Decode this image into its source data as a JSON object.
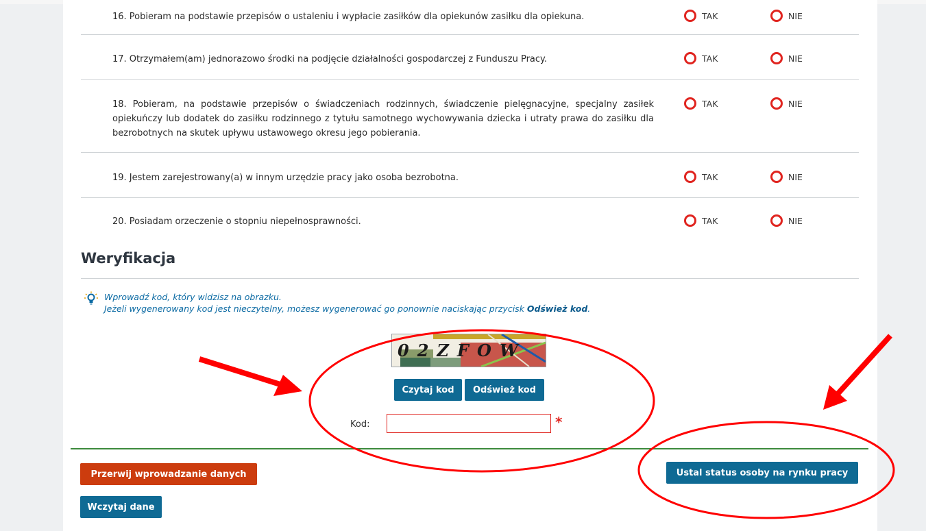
{
  "questions": [
    {
      "number_text": "16. Pobieram na podstawie przepisów o ustaleniu i wypłacie zasiłków dla opiekunów zasiłku dla opiekuna."
    },
    {
      "number_text": "17. Otrzymałem(am) jednorazowo środki na podjęcie działalności gospodarczej z Funduszu Pracy."
    },
    {
      "number_text": "18. Pobieram, na podstawie przepisów o świadczeniach rodzinnych, świadczenie pielęgnacyjne, specjalny zasiłek opiekuńczy lub dodatek do zasiłku rodzinnego z tytułu samotnego wychowywania dziecka i utraty prawa do zasiłku dla bezrobotnych na skutek upływu ustawowego okresu jego pobierania."
    },
    {
      "number_text": "19. Jestem zarejestrowany(a) w innym urzędzie pracy jako osoba bezrobotna."
    },
    {
      "number_text": "20. Posiadam orzeczenie o stopniu niepełnosprawności."
    }
  ],
  "options": {
    "yes": "TAK",
    "no": "NIE"
  },
  "verification": {
    "heading": "Weryfikacja",
    "hint_line1": "Wprowadź kod, który widzisz na obrazku.",
    "hint_line2_prefix": "Jeżeli wygenerowany kod jest nieczytelny, możesz wygenerować go ponownie naciskając przycisk ",
    "hint_line2_bold": "Odśwież kod",
    "hint_line2_suffix": ".",
    "captcha_text": "02ZFOW",
    "read_code_label": "Czytaj kod",
    "refresh_code_label": "Odśwież kod",
    "code_label": "Kod:",
    "code_value": "",
    "required_mark": "*"
  },
  "footer": {
    "abort_label": "Przerwij wprowadzanie danych",
    "load_label": "Wczytaj dane",
    "submit_label": "Ustal status osoby na rynku pracy"
  },
  "colors": {
    "accent_blue": "#0f6a94",
    "abort_orange": "#cc3c0e",
    "radio_red": "#e0241f",
    "annotation_red": "#ff0000",
    "divider_green": "#3c8a3c"
  }
}
